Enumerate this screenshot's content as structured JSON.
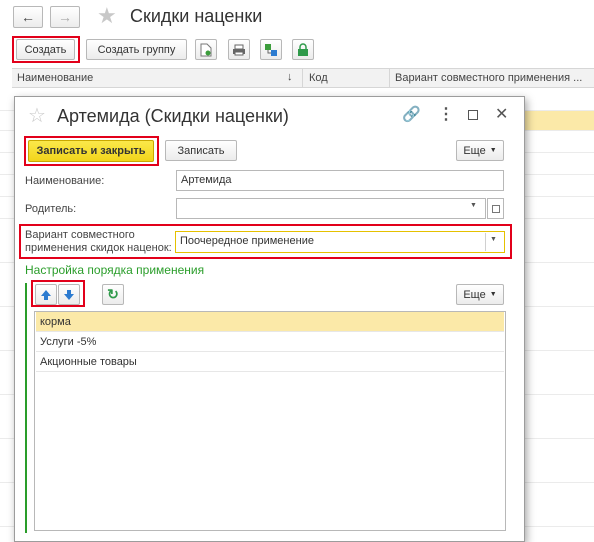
{
  "window": {
    "title": "Скидки наценки",
    "create_label": "Создать",
    "create_group_label": "Создать группу"
  },
  "list": {
    "columns": [
      "Наименование",
      "Код",
      "Вариант совместного применения ..."
    ],
    "sort_indicator": "↓"
  },
  "dialog": {
    "title": "Артемида (Скидки наценки)",
    "save_close_label": "Записать и закрыть",
    "save_label": "Записать",
    "more_label": "Еще",
    "fields": {
      "name_label": "Наименование:",
      "name_value": "Артемида",
      "parent_label": "Родитель:",
      "parent_value": "",
      "variant_label_line1": "Вариант совместного",
      "variant_label_line2": "применения скидок наценок:",
      "variant_value": "Поочередное применение"
    },
    "section_title": "Настройка порядка применения",
    "section_more_label": "Еще",
    "order_items": [
      "корма",
      "Услуги -5%",
      "Акционные товары"
    ]
  },
  "colors": {
    "accent_yellow": "#f9e231",
    "selected_row": "#fbe9a8",
    "highlight_red": "#e2001a",
    "section_green": "#2a9d2a"
  }
}
